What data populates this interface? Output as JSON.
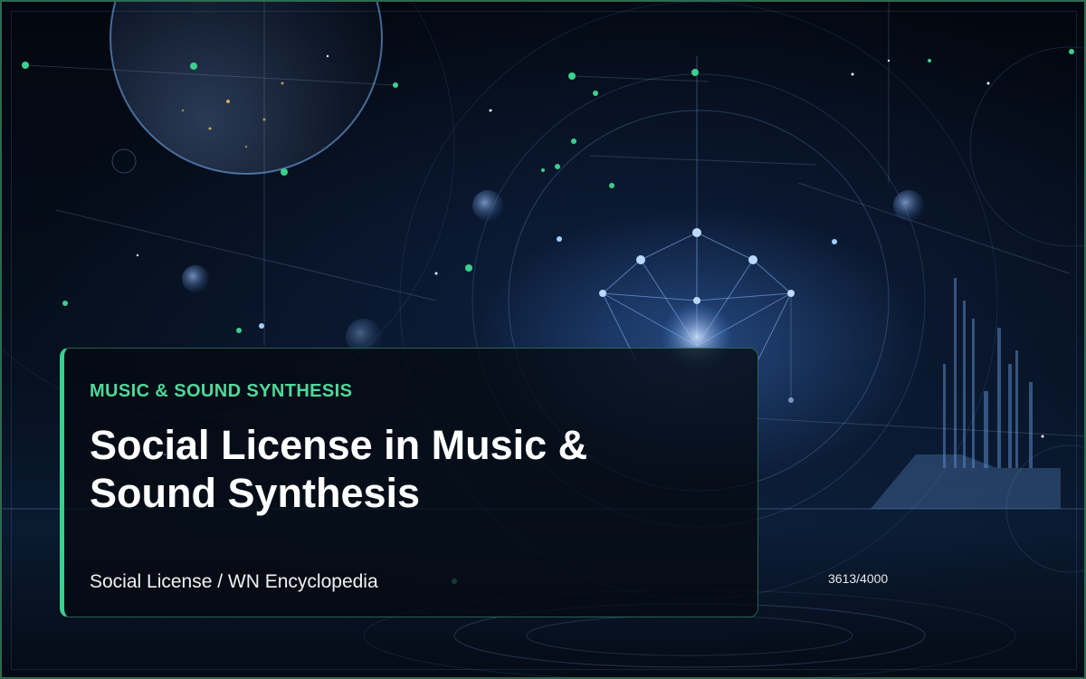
{
  "card": {
    "category": "MUSIC & SOUND SYNTHESIS",
    "title": "Social License in Music & Sound Synthesis",
    "subtitle": "Social License / WN Encyclopedia"
  },
  "counter": {
    "text": "3613/4000",
    "current": 3613,
    "total": 4000
  },
  "colors": {
    "accent": "#3ccf8e",
    "category_text": "#4fd99a",
    "frame": "#2f6a4f",
    "background": "#040912"
  },
  "background": {
    "description_icons": [
      "planet-icon",
      "sacred-geometry-icon",
      "city-skyline-icon"
    ]
  }
}
